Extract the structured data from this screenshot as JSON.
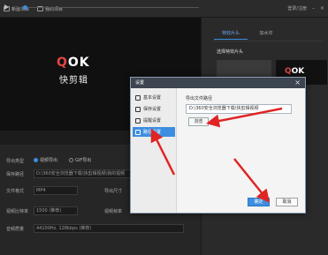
{
  "topbar": {
    "new_project": "新建项目",
    "my_projects": "我的项目",
    "login": "登录/注册"
  },
  "preview": {
    "logo_text": "OK",
    "logo_prefix": "Q",
    "app_name": "快剪辑"
  },
  "export_panel": {
    "export_type_label": "导出类型",
    "opt_video": "视频导出",
    "opt_gif": "GIF导出",
    "save_path_label": "保存路径",
    "save_path_value": "D:\\360安全浏览器下载\\快剪辑视频\\我的视频",
    "format_label": "文件格式",
    "format_value": "MP4",
    "size_label": "导出尺寸",
    "bitrate_label": "视频比特率",
    "bitrate_value": "1500 (推荐)",
    "framerate_label": "视频帧率",
    "audio_label": "音频质量",
    "audio_value": "44100Hz, 128kbps (推荐)"
  },
  "right_pane": {
    "tab_active": "特效片头",
    "tab_other": "加水印",
    "section_title": "选择特效片头",
    "thumb_logo": "OK"
  },
  "dialog": {
    "title": "设置",
    "close_glyph": "×",
    "nav": [
      {
        "label": "基本设置",
        "icon": "gear-icon"
      },
      {
        "label": "保存设置",
        "icon": "save-icon"
      },
      {
        "label": "提醒设置",
        "icon": "bell-icon"
      },
      {
        "label": "路径设置",
        "icon": "folder-icon"
      }
    ],
    "active_nav": 3,
    "section_label": "导出文件路径",
    "path_value": "D:\\360安全浏览器下载\\快剪辑视频",
    "browse_label": "浏览",
    "ok_label": "确定",
    "cancel_label": "取消"
  },
  "colors": {
    "accent": "#3d8ee0",
    "annotation_arrow": "#e02424",
    "dialog_title_bg": "#3c4550"
  }
}
